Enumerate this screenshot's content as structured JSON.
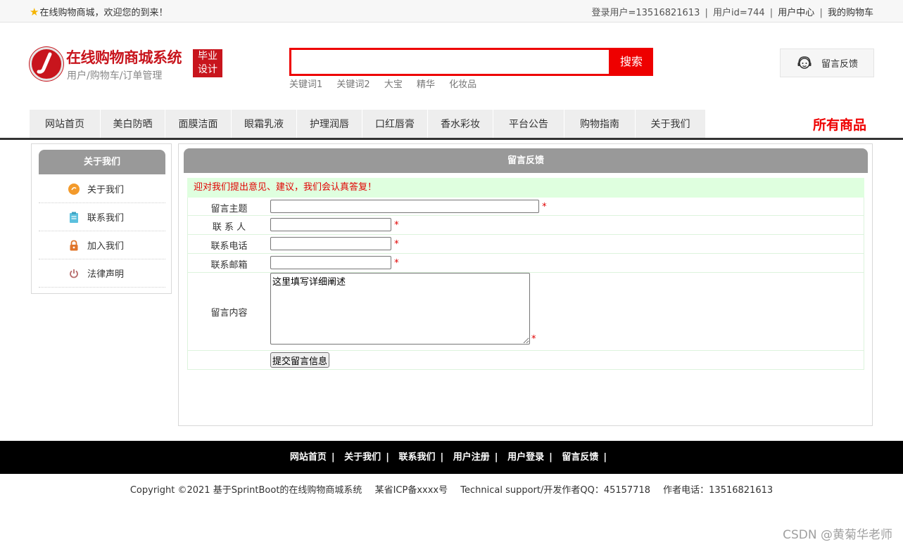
{
  "topbar": {
    "welcome": "在线购物商城，欢迎您的到来！",
    "login_user": "登录用户=13516821613",
    "user_id": "用户id=744",
    "user_center": "用户中心",
    "my_cart": "我的购物车",
    "separator": "|"
  },
  "header": {
    "logo_title": "在线购物商城系统",
    "logo_subtitle": "用户/购物车/订单管理",
    "badge_line1": "毕业",
    "badge_line2": "设计",
    "search_button": "搜索",
    "search_value": "",
    "keywords": [
      "关键词1",
      "关键词2",
      "大宝",
      "精华",
      "化妆品"
    ],
    "feedback_button": "留言反馈"
  },
  "nav": {
    "items": [
      "网站首页",
      "美白防晒",
      "面膜洁面",
      "眼霜乳液",
      "护理润唇",
      "口红唇膏",
      "香水彩妆",
      "平台公告",
      "购物指南",
      "关于我们"
    ],
    "all_goods": "所有商品"
  },
  "sidebar": {
    "title": "关于我们",
    "items": [
      {
        "label": "关于我们",
        "icon": "orange-circle-icon"
      },
      {
        "label": "联系我们",
        "icon": "clipboard-icon"
      },
      {
        "label": "加入我们",
        "icon": "lock-icon"
      },
      {
        "label": "法律声明",
        "icon": "power-icon"
      }
    ]
  },
  "main": {
    "title": "留言反馈",
    "notice": "迎对我们提出意见、建议，我们会认真答复！",
    "fields": {
      "subject_label": "留言主题",
      "contact_label": "联 系 人",
      "phone_label": "联系电话",
      "email_label": "联系邮箱",
      "content_label": "留言内容",
      "content_value": "这里填写详细阐述",
      "required_mark": "*"
    },
    "submit_label": "提交留言信息"
  },
  "footer": {
    "links": [
      "网站首页",
      "关于我们",
      "联系我们",
      "用户注册",
      "用户登录",
      "留言反馈"
    ],
    "separator": "|",
    "copyright": "Copyright ©2021 基于SprintBoot的在线购物商城系统",
    "icp": "某省ICP备xxxx号",
    "support": "Technical support/开发作者QQ：45157718",
    "phone": "作者电话：13516821613"
  },
  "watermark": "CSDN @黄菊华老师",
  "colors": {
    "brand_red": "#c8151d",
    "search_red": "#ee0000",
    "panel_gray": "#999999",
    "notice_bg": "#dfffdf"
  }
}
